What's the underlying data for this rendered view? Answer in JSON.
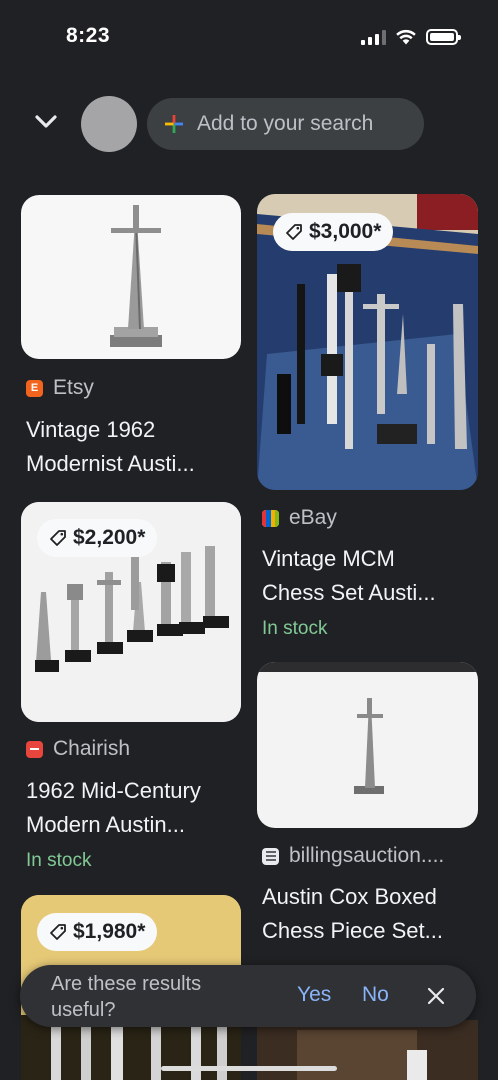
{
  "status": {
    "time": "8:23"
  },
  "header": {
    "search_placeholder": "Add to your search",
    "icons": {
      "collapse": "chevron-down-icon",
      "add": "google-plus-icon"
    }
  },
  "results": [
    {
      "source": "Etsy",
      "title": "Vintage 1962",
      "title2": "Modernist Austi...",
      "price": "",
      "stock": ""
    },
    {
      "source": "eBay",
      "title": "Vintage MCM",
      "title2": "Chess Set Austi...",
      "price": "$3,000*",
      "stock": "In stock"
    },
    {
      "source": "Chairish",
      "title": "1962 Mid-Century",
      "title2": "Modern Austin...",
      "price": "$2,200*",
      "stock": "In stock"
    },
    {
      "source": "billingsauction....",
      "title": "Austin Cox Boxed",
      "title2": "Chess Piece Set...",
      "price": "",
      "stock": ""
    },
    {
      "source": "",
      "title": "",
      "title2": "",
      "price": "$1,980*",
      "stock": ""
    }
  ],
  "feedback": {
    "question": "Are these results useful?",
    "yes": "Yes",
    "no": "No"
  },
  "colors": {
    "background": "#202124",
    "stock_green": "#81c995",
    "link_blue": "#8ab4f8",
    "etsy": "#f1641e",
    "chairish": "#e8453c"
  }
}
